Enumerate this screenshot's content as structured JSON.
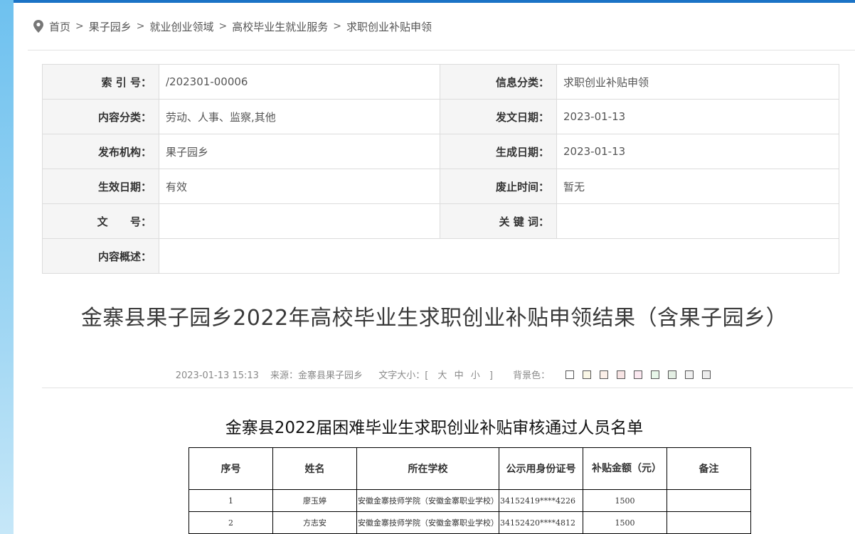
{
  "breadcrumb": [
    "首页",
    "果子园乡",
    "就业创业领域",
    "高校毕业生就业服务",
    "求职创业补贴申领"
  ],
  "meta": {
    "index_label": "索 引 号：",
    "index_value": "/202301-00006",
    "info_class_label": "信息分类：",
    "info_class_value": "求职创业补贴申领",
    "content_class_label": "内容分类：",
    "content_class_value": "劳动、人事、监察,其他",
    "issue_date_label": "发文日期：",
    "issue_date_value": "2023-01-13",
    "org_label": "发布机构：",
    "org_value": "果子园乡",
    "gen_date_label": "生成日期：",
    "gen_date_value": "2023-01-13",
    "effective_label": "生效日期：",
    "effective_value": "有效",
    "abolish_label": "废止时间：",
    "abolish_value": "暂无",
    "docno_label": "文      号：",
    "docno_value": "",
    "keyword_label": "关 键 词：",
    "keyword_value": "",
    "summary_label": "内容概述：",
    "summary_value": ""
  },
  "article": {
    "title": "金寨县果子园乡2022年高校毕业生求职创业补贴申领结果（含果子园乡）",
    "datetime": "2023-01-13 15:13",
    "source": "来源：金寨县果子园乡",
    "font_size_label": "文字大小：[",
    "font_large": "大",
    "font_mid": "中",
    "font_small": "小",
    "font_close": "]",
    "bg_label": "背景色：",
    "bg_colors": [
      "#ffffff",
      "#faf7e6",
      "#fbefe8",
      "#f7e4e4",
      "#fbe8f0",
      "#e7f6e9",
      "#e4efe4",
      "#f0f0f0",
      "#ececec"
    ]
  },
  "list": {
    "title": "金寨县2022届困难毕业生求职创业补贴审核通过人员名单",
    "headers": [
      "序号",
      "姓名",
      "所在学校",
      "公示用身份证号",
      "补贴金额（元）",
      "备注"
    ],
    "rows": [
      {
        "no": "1",
        "name": "廖玉婷",
        "school": "安徽金寨技师学院（安徽金寨职业学校）",
        "id": "34152419****4226",
        "amount": "1500",
        "note": ""
      },
      {
        "no": "2",
        "name": "方志安",
        "school": "安徽金寨技师学院（安徽金寨职业学校）",
        "id": "34152420****4812",
        "amount": "1500",
        "note": ""
      }
    ]
  }
}
